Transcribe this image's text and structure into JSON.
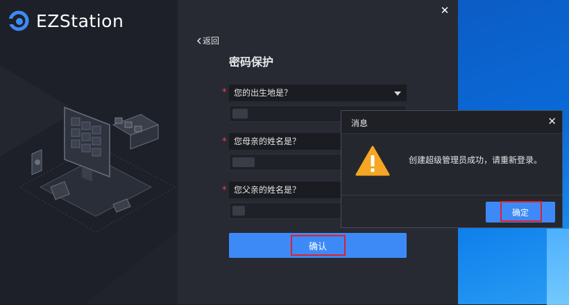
{
  "app": {
    "name": "EZStation"
  },
  "window": {
    "close_glyph": "✕",
    "back_label": "返回",
    "page_title": "密码保护"
  },
  "form": {
    "required_mark": "*",
    "questions": [
      {
        "label": "您的出生地是？",
        "answer": ""
      },
      {
        "label": "您母亲的姓名是？",
        "answer": ""
      },
      {
        "label": "您父亲的姓名是？",
        "answer": ""
      }
    ],
    "confirm_label": "确认"
  },
  "dialog": {
    "title": "消息",
    "close_glyph": "✕",
    "message": "创建超级管理员成功，请重新登录。",
    "ok_label": "确定",
    "icon": "warning-icon"
  },
  "colors": {
    "accent": "#3d8af7",
    "highlight": "#e0202a",
    "warning": "#f5a623",
    "required": "#ff3d3d"
  }
}
